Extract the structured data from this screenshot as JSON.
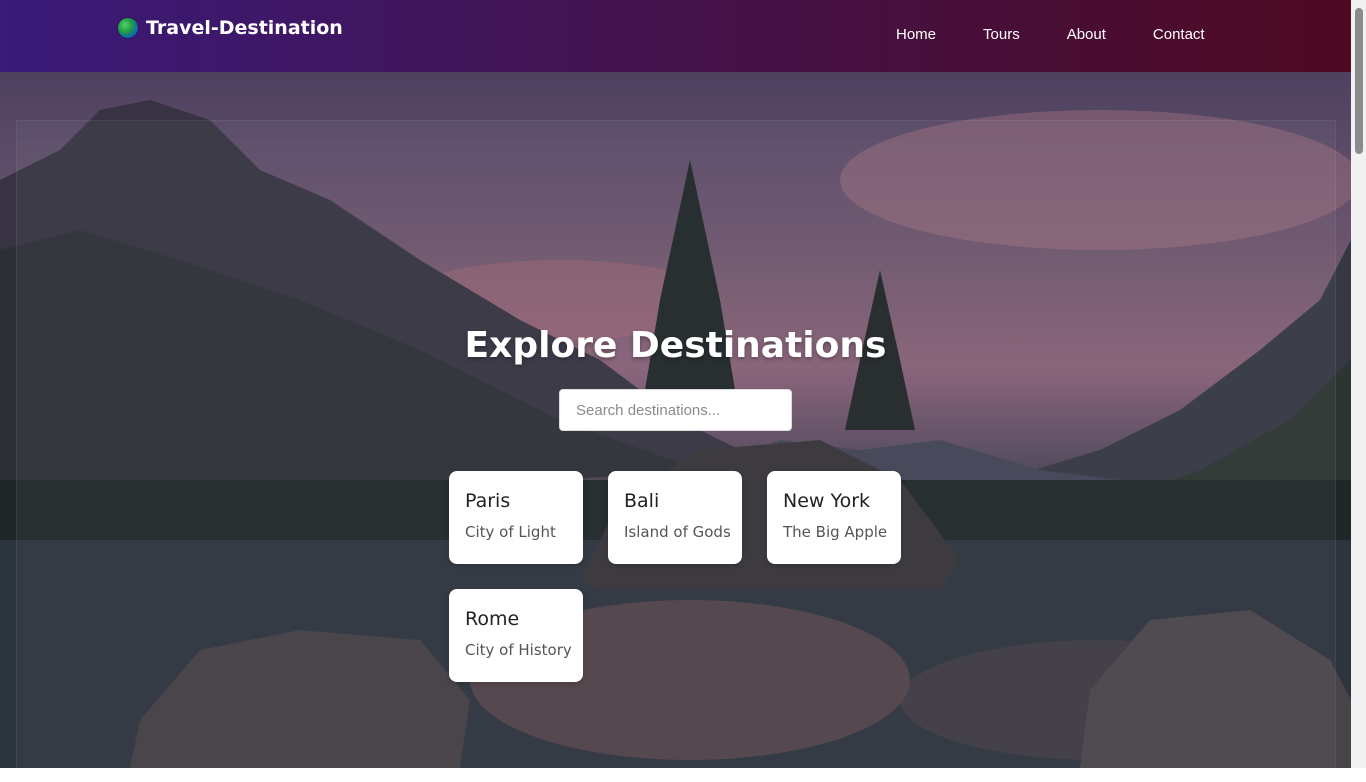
{
  "brand": {
    "name": "Travel-Destination",
    "icon": "globe-icon"
  },
  "nav": {
    "items": [
      "Home",
      "Tours",
      "About",
      "Contact"
    ]
  },
  "hero": {
    "title": "Explore Destinations",
    "search": {
      "placeholder": "Search destinations...",
      "value": ""
    }
  },
  "destinations": [
    {
      "name": "Paris",
      "tagline": "City of Light"
    },
    {
      "name": "Bali",
      "tagline": "Island of Gods"
    },
    {
      "name": "New York",
      "tagline": "The Big Apple"
    },
    {
      "name": "Rome",
      "tagline": "City of History"
    }
  ],
  "colors": {
    "header_start": "#3a1a7a",
    "header_end": "#4e0a22",
    "text": "#ffffff"
  }
}
